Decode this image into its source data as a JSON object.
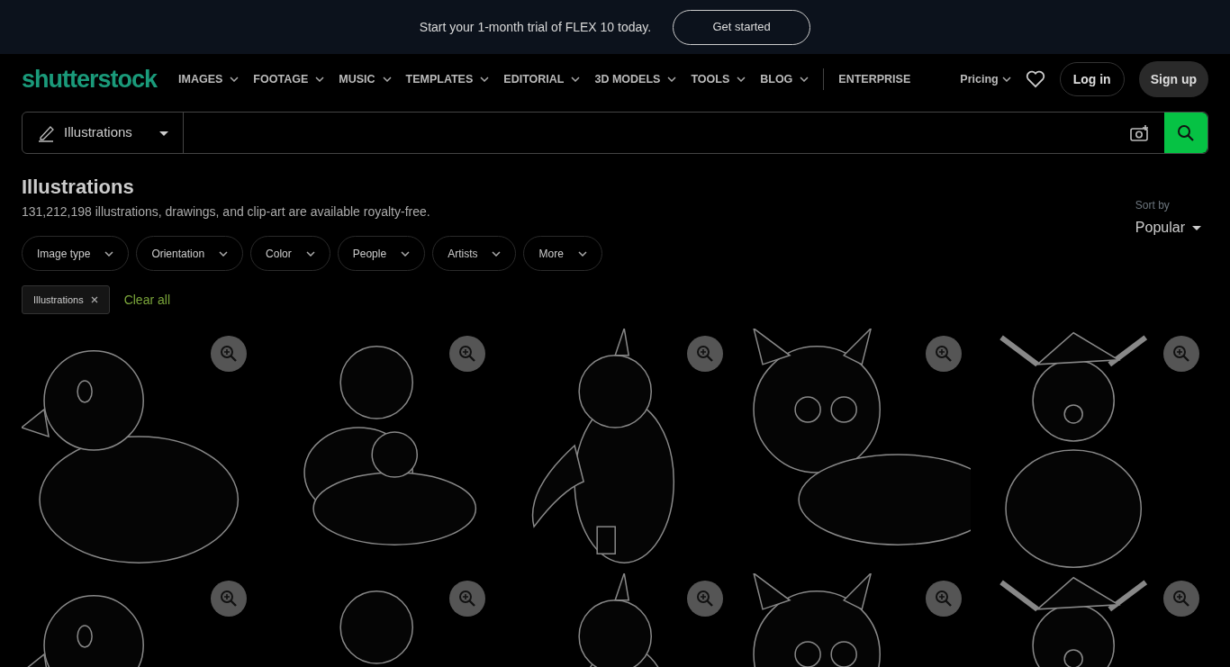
{
  "banner": {
    "text": "Start your 1-month trial of FLEX 10 today.",
    "button": "Get started"
  },
  "logo": {
    "text": "shutterstock"
  },
  "nav": [
    {
      "label": "IMAGES",
      "dropdown": true
    },
    {
      "label": "FOOTAGE",
      "dropdown": true
    },
    {
      "label": "MUSIC",
      "dropdown": true
    },
    {
      "label": "TEMPLATES",
      "dropdown": true
    },
    {
      "label": "EDITORIAL",
      "dropdown": true
    },
    {
      "label": "3D MODELS",
      "dropdown": true
    },
    {
      "label": "TOOLS",
      "dropdown": true
    },
    {
      "label": "BLOG",
      "dropdown": true
    },
    {
      "label": "ENTERPRISE",
      "dropdown": false
    }
  ],
  "account": {
    "pricing": "Pricing",
    "login": "Log in",
    "signup": "Sign up"
  },
  "search": {
    "type": "Illustrations"
  },
  "heading": {
    "title": "Illustrations",
    "subtitle": "131,212,198 illustrations, drawings, and clip-art are available royalty-free."
  },
  "filters": [
    "Image type",
    "Orientation",
    "Color",
    "People",
    "Artists",
    "More"
  ],
  "sort": {
    "label": "Sort by",
    "value": "Popular"
  },
  "active_filters": [
    {
      "label": "Illustrations"
    }
  ],
  "clear_all": "Clear all"
}
